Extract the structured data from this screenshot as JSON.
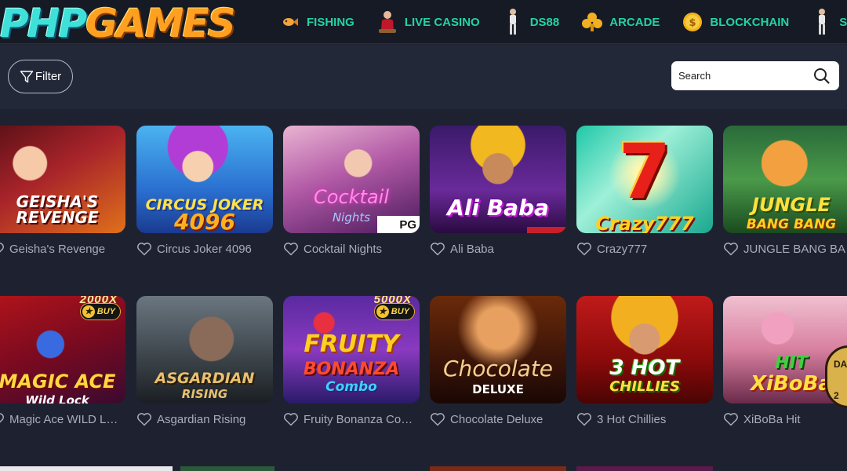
{
  "logo": {
    "part1": "PHP",
    "part2": "GAMES"
  },
  "nav": {
    "items": [
      {
        "label": "FISHING",
        "icon": "fish-icon"
      },
      {
        "label": "LIVE CASINO",
        "icon": "dealer-icon"
      },
      {
        "label": "DS88",
        "icon": "athlete-icon"
      },
      {
        "label": "ARCADE",
        "icon": "club-icon"
      },
      {
        "label": "BLOCKCHAIN",
        "icon": "coin-icon"
      },
      {
        "label": "SPORTS",
        "icon": "athlete-icon"
      }
    ]
  },
  "toolbar": {
    "filter_label": "Filter",
    "search_placeholder": "Search"
  },
  "games": {
    "row1": [
      {
        "name": "Geisha's Revenge",
        "art_title": "GEISHA'S REVENGE"
      },
      {
        "name": "Circus Joker 4096",
        "art_title": "CIRCUS JOKER",
        "art_sub": "4096"
      },
      {
        "name": "Cocktail Nights",
        "art_title": "Cocktail",
        "art_sub": "Nights",
        "provider": "PG"
      },
      {
        "name": "Ali Baba",
        "art_title": "Ali Baba"
      },
      {
        "name": "Crazy777",
        "art_title": "7",
        "art_sub": "Crazy777"
      },
      {
        "name": "JUNGLE BANG BANG",
        "art_title": "JUNGLE",
        "art_sub": "BANG BANG"
      }
    ],
    "row2": [
      {
        "name": "Magic Ace WILD LOCK",
        "art_title": "MAGIC ACE",
        "art_sub": "Wild Lock",
        "buy": "BUY",
        "mult": "2000X"
      },
      {
        "name": "Asgardian Rising",
        "art_title": "ASGARDIAN",
        "art_sub": "RISING"
      },
      {
        "name": "Fruity Bonanza Combo",
        "art_title": "FRUITY",
        "art_sub": "BONANZA",
        "art_sub2": "Combo",
        "buy": "BUY",
        "mult": "5000X"
      },
      {
        "name": "Chocolate Deluxe",
        "art_title": "Chocolate",
        "art_sub": "DELUXE"
      },
      {
        "name": "3 Hot Chillies",
        "art_title": "3 HOT",
        "art_sub": "CHILLIES"
      },
      {
        "name": "XiBoBa Hit",
        "art_title": "HIT",
        "art_sub": "XiBoBa"
      }
    ]
  },
  "daily_badge": {
    "line1": "DAIL",
    "line2": "2"
  },
  "colors": {
    "nav_text": "#22d3a6",
    "page_bg": "#1e2230",
    "card_label": "#a9adb8"
  }
}
